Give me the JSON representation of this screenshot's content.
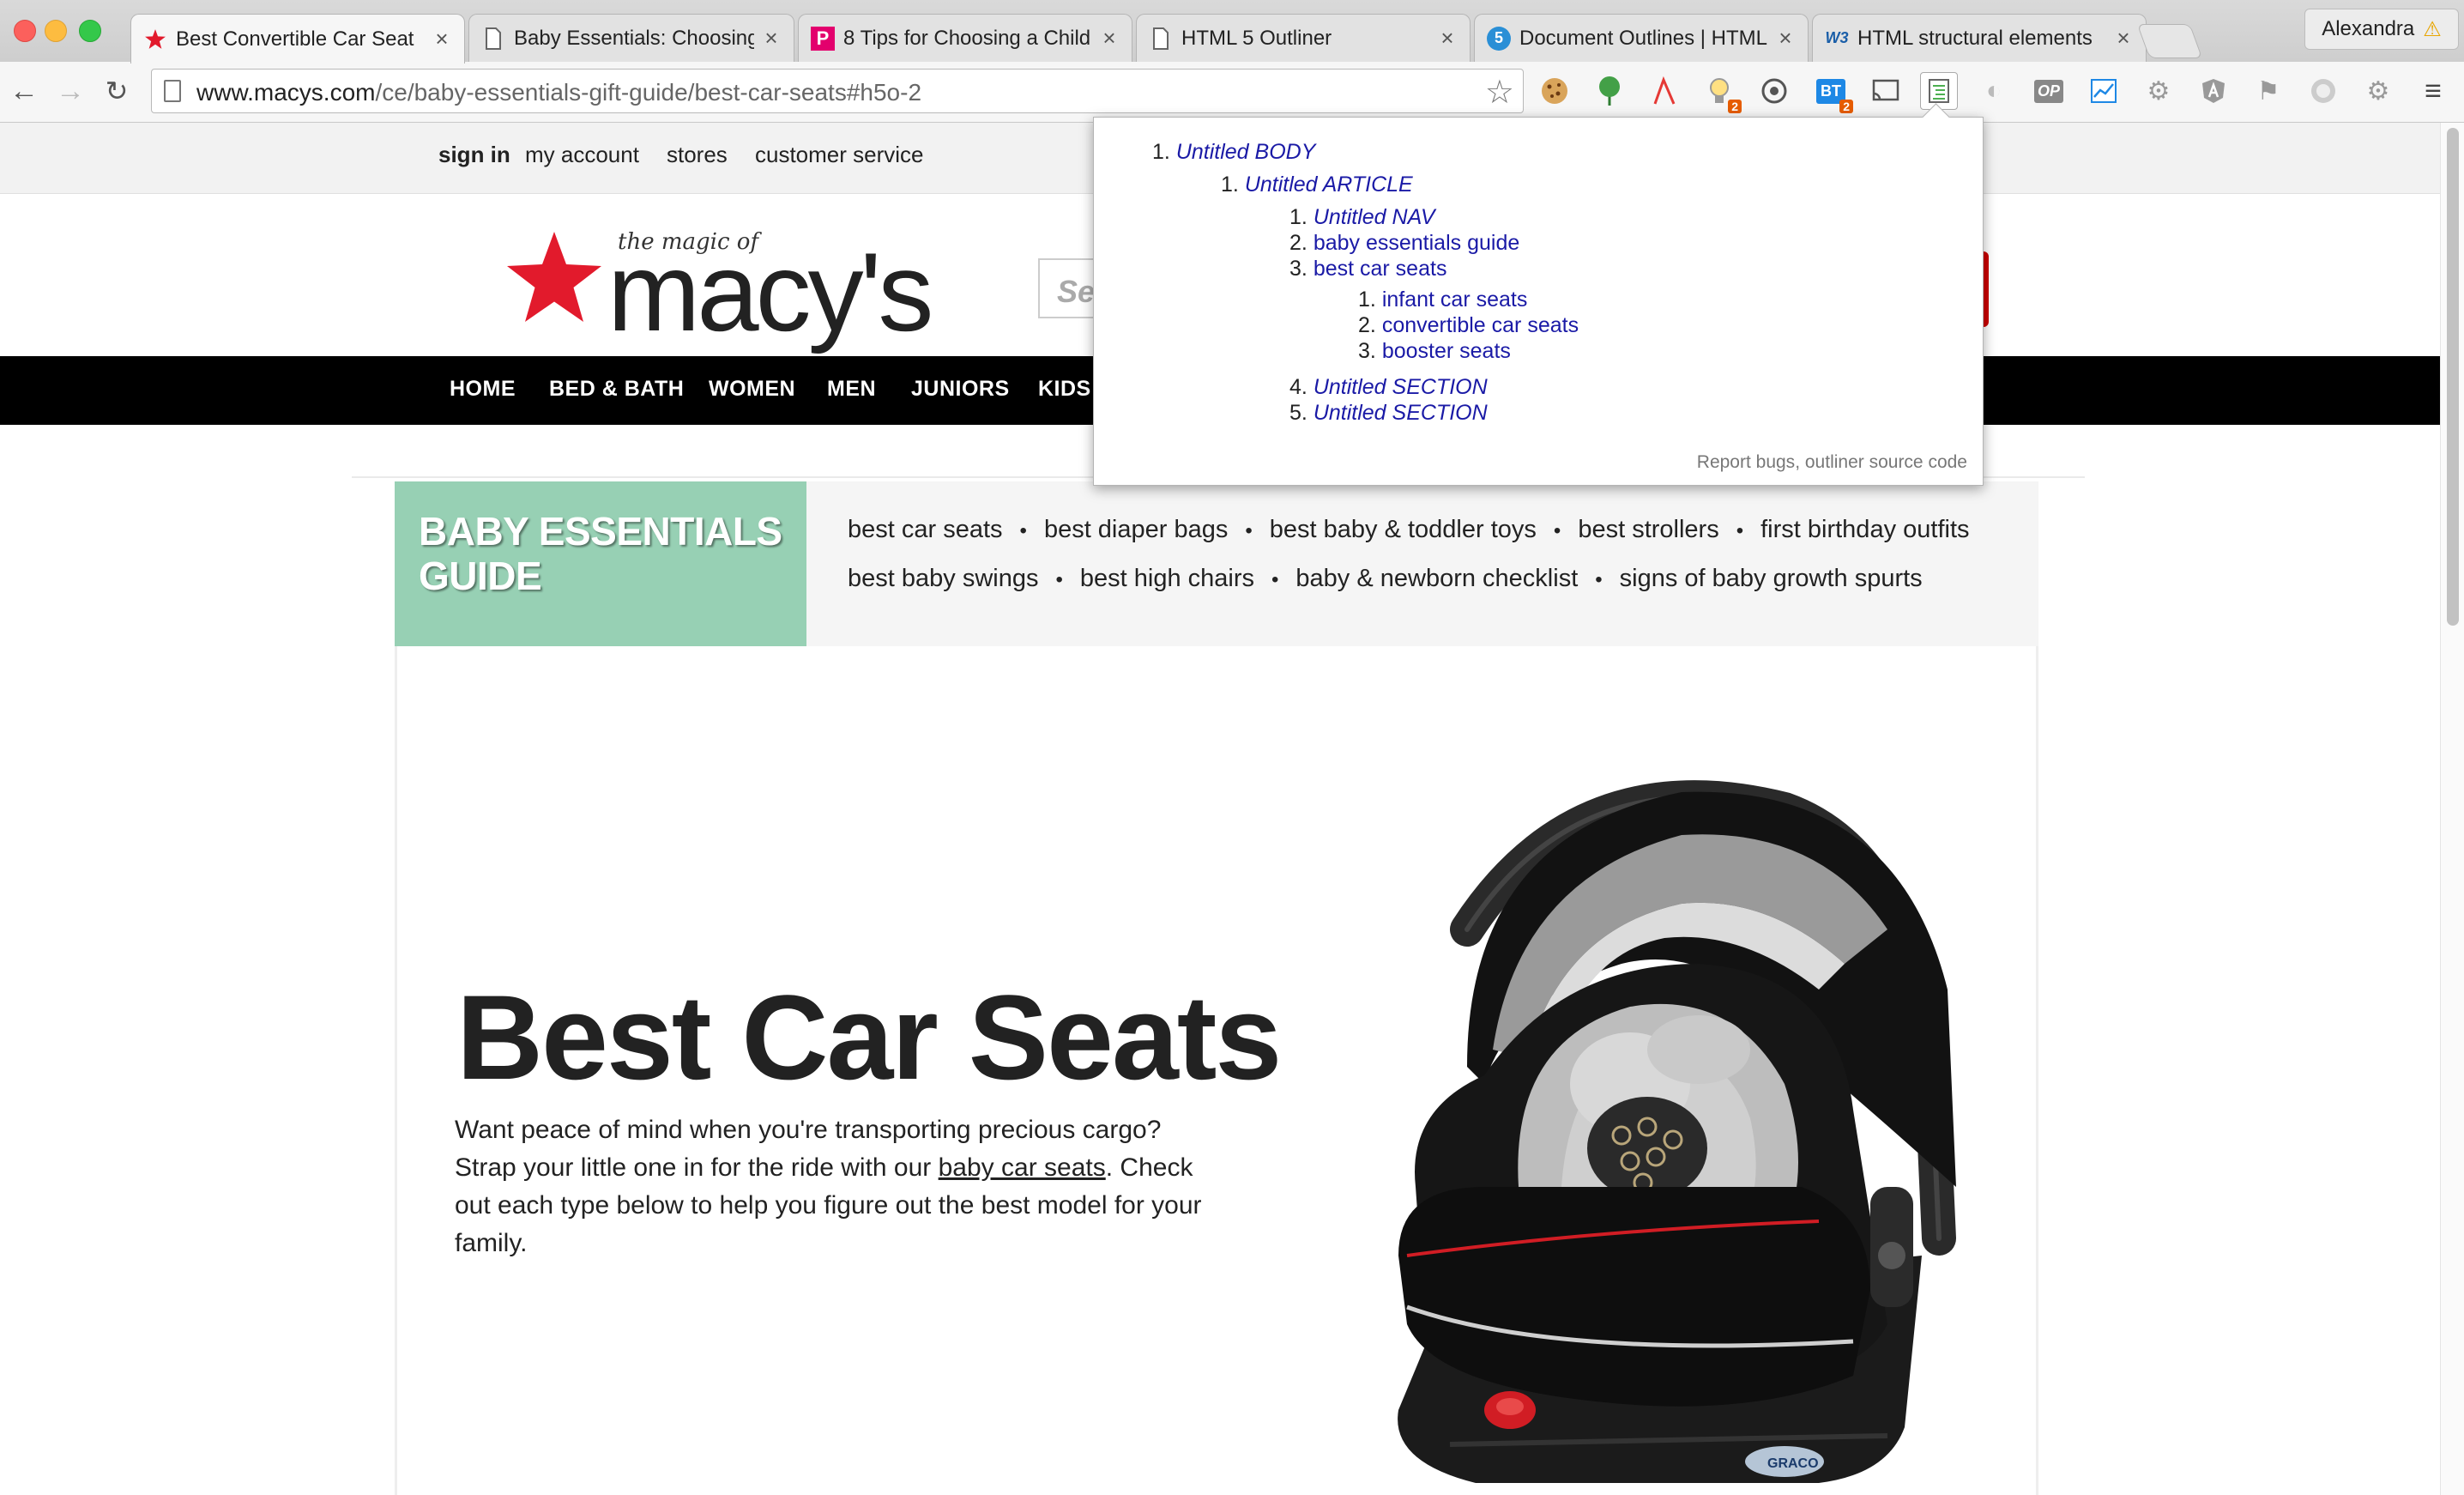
{
  "browser": {
    "tabs": [
      {
        "title": "Best Convertible Car Seat",
        "favicon": "macys-star-icon",
        "active": true
      },
      {
        "title": "Baby Essentials: Choosing",
        "favicon": "document-icon",
        "active": false
      },
      {
        "title": "8 Tips for Choosing a Child",
        "favicon": "p-logo-icon",
        "active": false
      },
      {
        "title": "HTML 5 Outliner",
        "favicon": "document-icon",
        "active": false
      },
      {
        "title": "Document Outlines | HTML",
        "favicon": "s-logo-icon",
        "active": false
      },
      {
        "title": "HTML structural elements",
        "favicon": "w3-logo-icon",
        "active": false
      }
    ],
    "profile_name": "Alexandra",
    "url_host": "www.macys.com",
    "url_path": "/ce/baby-essentials-gift-guide/best-car-seats#h5o-2",
    "extension_badges": {
      "bulb": "2",
      "bt": "2"
    },
    "favicon_text": {
      "p": "P",
      "s": "5",
      "w3": "W3",
      "bt": "BT",
      "op": "OP"
    }
  },
  "page": {
    "utility_links": [
      "sign in",
      "my account",
      "stores",
      "customer service"
    ],
    "brand": {
      "tagline": "the magic of",
      "wordmark": "macy's"
    },
    "search_placeholder": "Se",
    "nav": [
      "HOME",
      "BED & BATH",
      "WOMEN",
      "MEN",
      "JUNIORS",
      "KIDS"
    ],
    "guide": {
      "title_line1": "BABY ESSENTIALS",
      "title_line2": "GUIDE",
      "links_row1": [
        "best car seats",
        "best diaper bags",
        "best baby & toddler toys",
        "best strollers",
        "first birthday outfits"
      ],
      "links_row2": [
        "best baby swings",
        "best high chairs",
        "baby & newborn checklist",
        "signs of baby growth spurts"
      ],
      "separator": "•"
    },
    "hero": {
      "title": "Best Car Seats",
      "text_before": "Want peace of mind when you're transporting precious cargo? Strap your little one in for the ride with our ",
      "text_link": "baby car seats",
      "text_after": ". Check out each type below to help you figure out the best model for your family.",
      "product_brand": "GRACO"
    }
  },
  "outliner": {
    "items": [
      {
        "num": "1.",
        "text": "Untitled BODY",
        "untitled": true
      },
      {
        "num": "1.",
        "text": "Untitled ARTICLE",
        "untitled": true
      },
      {
        "num": "1.",
        "text": "Untitled NAV",
        "untitled": true
      },
      {
        "num": "2.",
        "text": "baby essentials guide",
        "untitled": false
      },
      {
        "num": "3.",
        "text": "best car seats",
        "untitled": false
      },
      {
        "num": "1.",
        "text": "infant car seats",
        "untitled": false
      },
      {
        "num": "2.",
        "text": "convertible car seats",
        "untitled": false
      },
      {
        "num": "3.",
        "text": "booster seats",
        "untitled": false
      },
      {
        "num": "4.",
        "text": "Untitled SECTION",
        "untitled": true
      },
      {
        "num": "5.",
        "text": "Untitled SECTION",
        "untitled": true
      }
    ],
    "footer_links": [
      "Report bugs",
      "outliner source code"
    ],
    "footer_separator": ","
  },
  "colors": {
    "macys_red": "#e21a2c",
    "guide_green": "#97d0b4",
    "link_blue": "#1a1aa6",
    "nav_black": "#000000"
  }
}
